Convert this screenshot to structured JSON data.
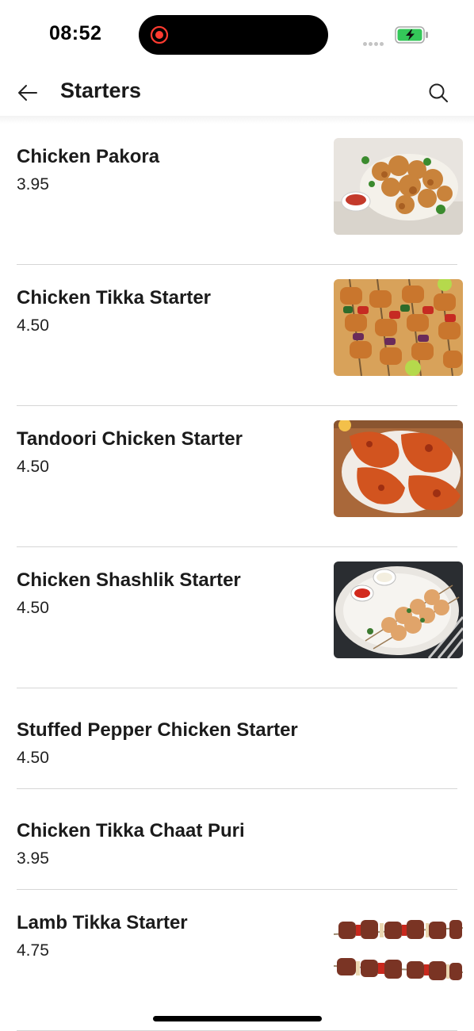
{
  "status": {
    "time": "08:52"
  },
  "header": {
    "title": "Starters"
  },
  "items": [
    {
      "name": "Chicken Pakora",
      "price": "3.95",
      "image": "chicken-pakora-photo"
    },
    {
      "name": "Chicken Tikka Starter",
      "price": "4.50",
      "image": "chicken-tikka-photo"
    },
    {
      "name": "Tandoori Chicken Starter",
      "price": "4.50",
      "image": "tandoori-chicken-photo"
    },
    {
      "name": "Chicken Shashlik Starter",
      "price": "4.50",
      "image": "chicken-shashlik-photo"
    },
    {
      "name": "Stuffed Pepper Chicken Starter",
      "price": "4.50"
    },
    {
      "name": "Chicken Tikka Chaat Puri",
      "price": "3.95"
    },
    {
      "name": "Lamb Tikka Starter",
      "price": "4.75",
      "image": "lamb-tikka-photo"
    }
  ],
  "colors": {
    "battery": "#34c759",
    "record": "#ff3b30",
    "divider": "#d6d6d6"
  },
  "icons": [
    "back-arrow-icon",
    "search-icon",
    "record-indicator-icon",
    "signal-icon",
    "battery-icon"
  ]
}
